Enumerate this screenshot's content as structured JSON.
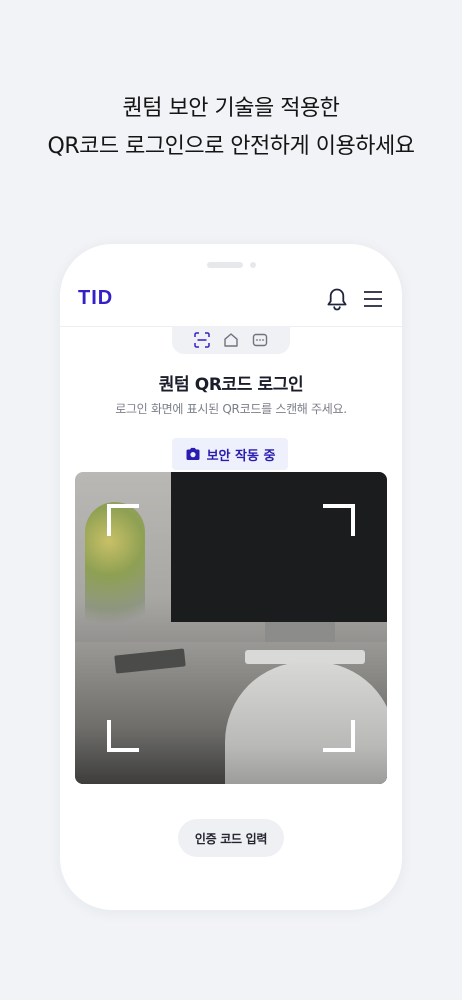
{
  "promo": {
    "line1": "퀀텀 보안 기술을 적용한",
    "line2": "QR코드 로그인으로 안전하게 이용하세요"
  },
  "app": {
    "logo": "TID",
    "header_icons": [
      "bell-icon",
      "menu-icon"
    ],
    "tabs": [
      "qr-scan-icon",
      "home-icon",
      "more-icon"
    ],
    "brand_color": "#3320c8"
  },
  "login": {
    "title": "퀀텀 QR코드 로그인",
    "subtitle": "로그인 화면에 표시된 QR코드를 스캔해 주세요.",
    "security_status": "보안 작동 중",
    "code_button": "인증 코드 입력"
  }
}
